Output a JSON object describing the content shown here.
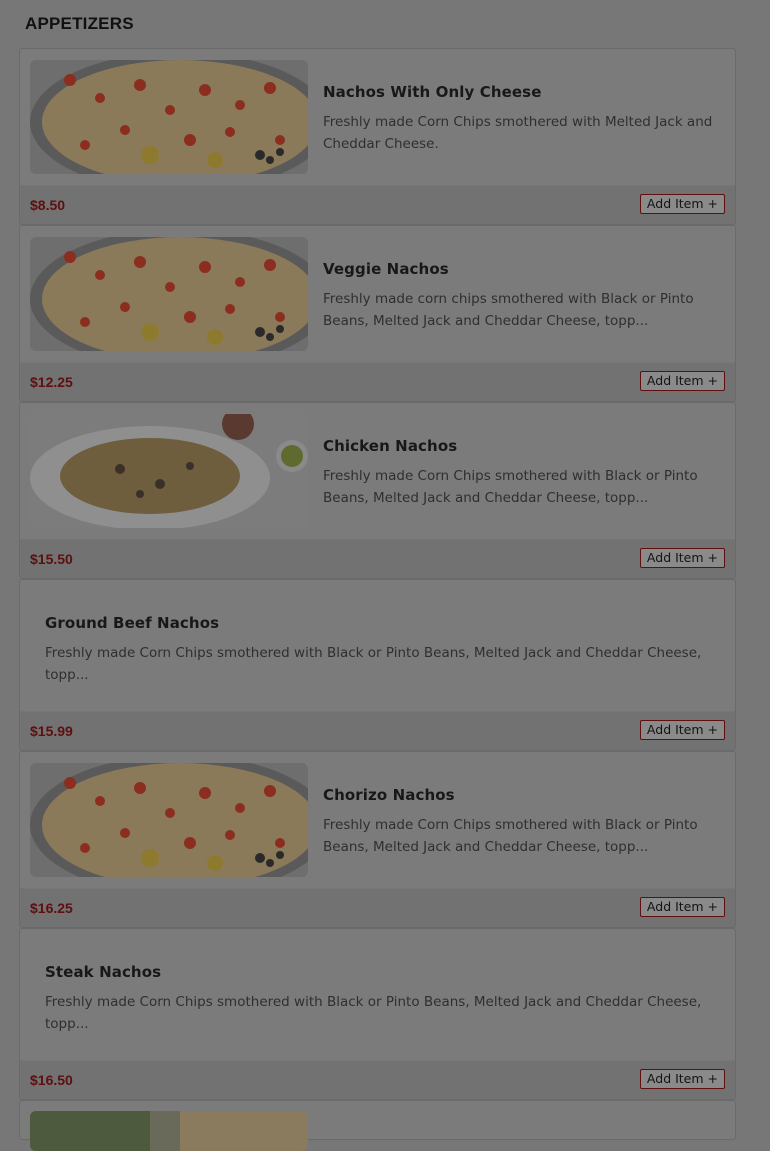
{
  "section": {
    "title": "APPETIZERS"
  },
  "items": [
    {
      "name": "Nachos With Only Cheese",
      "description": "Freshly made Corn Chips smothered with Melted Jack and Cheddar Cheese.",
      "price": "$8.50",
      "button": "Add Item +",
      "image": "nachos-photo"
    },
    {
      "name": "Veggie Nachos",
      "description": "Freshly made corn chips smothered with Black or Pinto Beans, Melted Jack and Cheddar Cheese, topp...",
      "price": "$12.25",
      "button": "Add Item +",
      "image": "nachos-photo"
    },
    {
      "name": "Chicken Nachos",
      "description": "Freshly made Corn Chips smothered with Black or Pinto Beans, Melted Jack and Cheddar Cheese, topp...",
      "price": "$15.50",
      "button": "Add Item +",
      "image": "chicken-nachos-photo"
    },
    {
      "name": "Ground Beef Nachos",
      "description": "Freshly made Corn Chips smothered with Black or Pinto Beans, Melted Jack and Cheddar Cheese, topp...",
      "price": "$15.99",
      "button": "Add Item +",
      "image": null
    },
    {
      "name": "Chorizo Nachos",
      "description": "Freshly made Corn Chips smothered with Black or Pinto Beans, Melted Jack and Cheddar Cheese, topp...",
      "price": "$16.25",
      "button": "Add Item +",
      "image": "nachos-photo"
    },
    {
      "name": "Steak Nachos",
      "description": "Freshly made Corn Chips smothered with Black or Pinto Beans, Melted Jack and Cheddar Cheese, topp...",
      "price": "$16.50",
      "button": "Add Item +",
      "image": null
    }
  ],
  "colors": {
    "overlay": "#777777",
    "price": "#5e0f0f",
    "button_border": "#5e0f0f"
  }
}
